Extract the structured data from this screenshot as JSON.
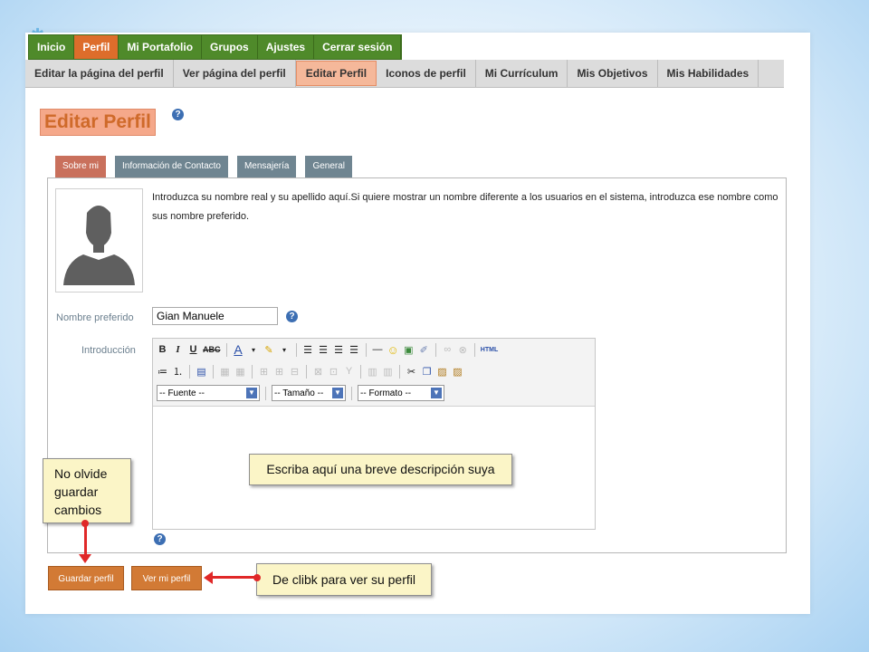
{
  "main_nav": [
    "Inicio",
    "Perfil",
    "Mi Portafolio",
    "Grupos",
    "Ajustes",
    "Cerrar sesión"
  ],
  "sub_nav": [
    "Editar la página del perfil",
    "Ver página del perfil",
    "Editar Perfil",
    "Iconos de perfil",
    "Mi Currículum",
    "Mis Objetivos",
    "Mis Habilidades"
  ],
  "page_title": "Editar Perfil",
  "tabs": [
    "Sobre mi",
    "Información de Contacto",
    "Mensajería",
    "General"
  ],
  "description": "Introduzca su nombre real y su apellido aquí.Si quiere mostrar un nombre diferente a los usuarios en el sistema, introduzca ese nombre como sus nombre preferido.",
  "form": {
    "preferred_name_label": "Nombre preferido",
    "preferred_name_value": "Gian Manuele",
    "intro_label": "Introducción"
  },
  "editor": {
    "font_select": "-- Fuente --",
    "size_select": "-- Tamaño --",
    "format_select": "-- Formato --",
    "html_label": "HTML"
  },
  "callouts": {
    "editor_hint": "Escriba aquí una breve descripción suya",
    "save_hint": "No olvide guardar cambios",
    "profile_hint": "De clibk para ver su perfil"
  },
  "buttons": {
    "save": "Guardar perfil",
    "view": "Ver mi perfil"
  },
  "colors": {
    "nav_green": "#4f8a2a",
    "active_orange": "#dd6d2b",
    "tab_gray": "#6f8591",
    "button_orange": "#d27a35",
    "arrow_red": "#e02828",
    "callout_yellow": "#fbf5c7"
  }
}
